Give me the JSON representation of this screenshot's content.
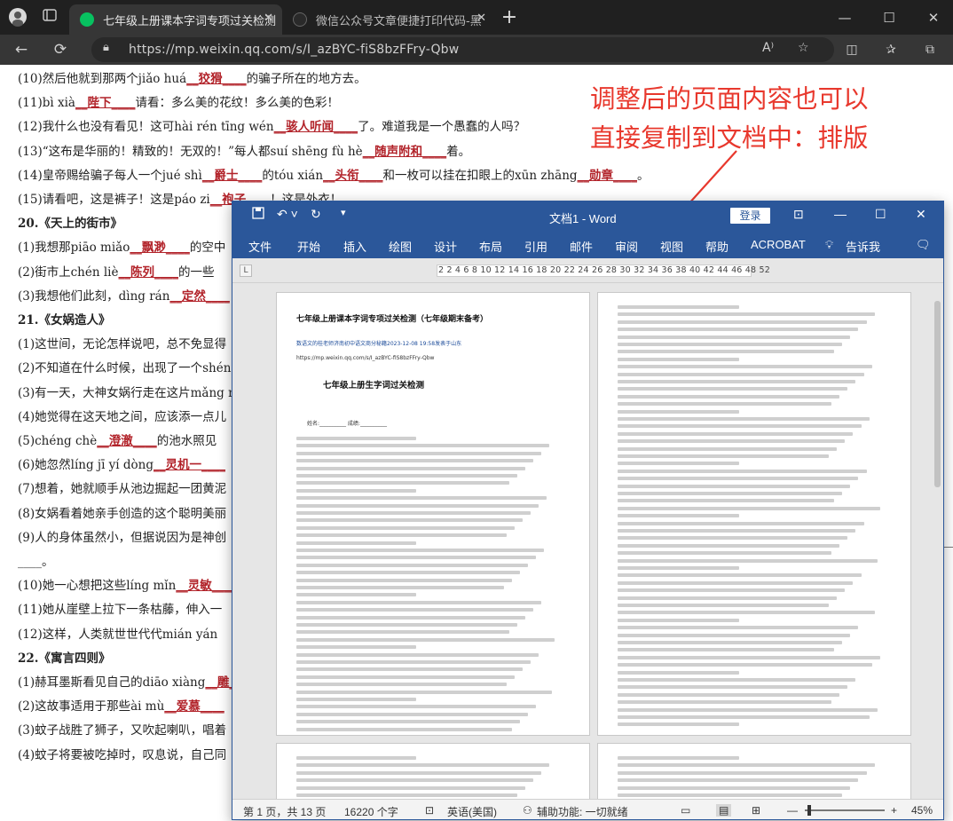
{
  "browser": {
    "tab1_title": "七年级上册课本字词专项过关检测",
    "tab2_title": "微信公众号文章便捷打印代码-黑",
    "url": "https://mp.weixin.qq.com/s/I_azBYC-fiS8bzFFry-Qbw",
    "new_tab_label": "+"
  },
  "article": {
    "lines": [
      {
        "pre": "(10)然后他就到那两个jiǎo huá",
        "ans": "狡猾",
        "post": "的骗子所在的地方去。"
      },
      {
        "pre": "(11)bì xià",
        "ans": "陛下",
        "post": "请看：多么美的花纹！多么美的色彩！"
      },
      {
        "pre": "(12)我什么也没有看见！这可hài rén tīng wén",
        "ans": "骇人听闻",
        "post": "了。难道我是一个愚蠢的人吗？"
      },
      {
        "pre": "(13)“这布是华丽的！精致的！无双的！”每人都suí shēng fù hè",
        "ans": "随声附和",
        "post": "着。"
      },
      {
        "pre": "(14)皇帝赐给骗子每人一个jué shì",
        "ans": "爵士",
        "post": "的tóu xián",
        "ans2": "头衔",
        "post2": "和一枚可以挂在扣眼上的xūn zhāng",
        "ans3": "勋章",
        "post3": "。"
      },
      {
        "pre": "(15)请看吧，这是裤子！这是páo zi",
        "ans": "袍子",
        "post": "！这是外衣！"
      },
      {
        "head": "20.《天上的街市》"
      },
      {
        "pre": "(1)我想那piāo miǎo",
        "ans": "飘渺",
        "post": "的空中"
      },
      {
        "pre": "(2)街市上chén liè",
        "ans": "陈列",
        "post": "的一些"
      },
      {
        "pre": "(3)我想他们此刻，dìng rán",
        "ans": "定然",
        "post": ""
      },
      {
        "head": "21.《女娲造人》"
      },
      {
        "pre": "(1)这世间，无论怎样说吧，总不免显得",
        "ans": "",
        "post": ""
      },
      {
        "pre": "(2)不知道在什么时候，出现了一个shén",
        "ans": "",
        "post": ""
      },
      {
        "pre": "(3)有一天，大神女娲行走在这片mǎng n",
        "ans": "",
        "post": ""
      },
      {
        "pre": "(4)她觉得在这天地之间，应该添一点儿",
        "ans": "",
        "post": ""
      },
      {
        "pre": "(5)chéng chè",
        "ans": "澄澈",
        "post": "的池水照见"
      },
      {
        "pre": "(6)她忽然líng jī yí dòng",
        "ans": "灵机一",
        "post": ""
      },
      {
        "pre": "(7)想着，她就顺手从池边掘起一团黄泥",
        "ans": "",
        "post": ""
      },
      {
        "pre": "(8)女娲看着她亲手创造的这个聪明美丽",
        "ans": "",
        "post": ""
      },
      {
        "pre": "(9)人的身体虽然小，但据说因为是神创",
        "ans": "",
        "post": ""
      },
      {
        "pre": "____。",
        "ans": "",
        "post": ""
      },
      {
        "pre": "(10)她一心想把这些líng mǐn",
        "ans": "灵敏",
        "post": ""
      },
      {
        "pre": "(11)她从崖壁上拉下一条枯藤，伸入一",
        "ans": "",
        "post": ""
      },
      {
        "pre": "(12)这样，人类就世世代代mián yán",
        "ans": "",
        "post": ""
      },
      {
        "head": "22.《寓言四则》"
      },
      {
        "pre": "(1)赫耳墨斯看见自己的diāo xiàng",
        "ans": "雕",
        "post": ""
      },
      {
        "pre": "(2)这故事适用于那些ài mù",
        "ans": "爱慕",
        "post": ""
      },
      {
        "pre": "(3)蚊子战胜了狮子，又吹起喇叭，唱着",
        "ans": "",
        "post": ""
      },
      {
        "pre": "(4)蚊子将要被吃掉时，叹息说，自己同",
        "ans": "",
        "post": ""
      }
    ],
    "annotation_line1": "调整后的页面内容也可以",
    "annotation_line2": "直接复制到文档中：排版"
  },
  "word": {
    "doc_title": "文档1 - Word",
    "login": "登录",
    "ribbon": [
      "文件",
      "开始",
      "插入",
      "绘图",
      "设计",
      "布局",
      "引用",
      "邮件",
      "审阅",
      "视图",
      "帮助",
      "ACROBAT",
      "告诉我"
    ],
    "ruler": "2  2  4  6  8  10 12 14 16 18 20 22 24 26 28 30 32 34 36 38 40 42 44 46 48  52",
    "page1_title": "七年级上册课本字词专项过关检测（七年级期末备考）",
    "page1_meta": "数语文的桂老师济南初中语文商分秘籍2023-12-08 19:58发表于山东",
    "page1_url": "https://mp.weixin.qq.com/s/I_azBYC-fiS8bzFFry-Qbw",
    "page1_heading": "七年级上册生字词过关检测",
    "page1_sub": "姓名:__________    成绩:__________",
    "status_page": "第 1 页，共 13 页",
    "status_words": "16220 个字",
    "status_lang": "英语(美国)",
    "status_access": "辅助功能: 一切就绪",
    "status_zoom": "45%"
  }
}
